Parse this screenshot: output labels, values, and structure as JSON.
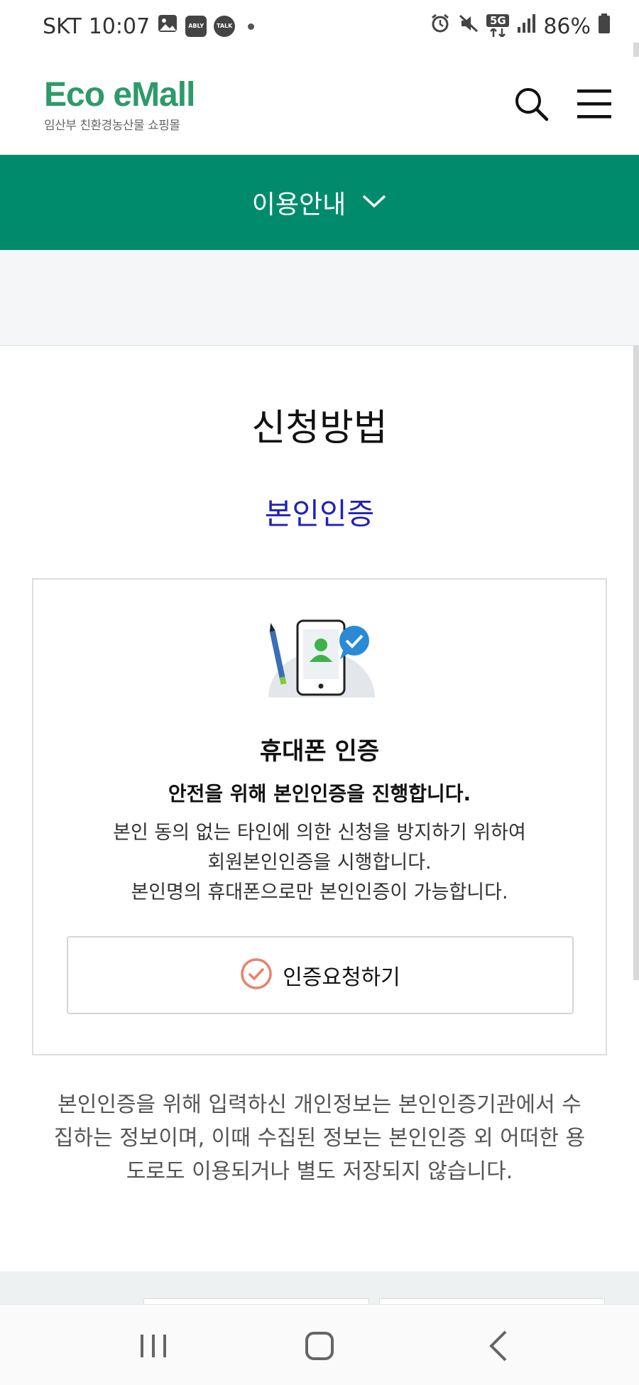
{
  "status_bar": {
    "carrier": "SKT",
    "time": "10:07",
    "notification_icons": [
      "gallery-icon",
      "ably-icon",
      "talk-icon"
    ],
    "ably_label": "ABLY",
    "talk_label": "TALK",
    "right_icons": [
      "alarm-icon",
      "mute-icon",
      "5g-icon",
      "signal-icon"
    ],
    "network_label": "5G",
    "battery": "86%"
  },
  "header": {
    "logo_title": "Eco eMall",
    "logo_subtitle": "임산부 친환경농산물 쇼핑몰",
    "search_icon": "search-icon",
    "menu_icon": "hamburger-menu-icon"
  },
  "guide_nav": {
    "label": "이용안내",
    "icon": "chevron-down-icon"
  },
  "main": {
    "title": "신청방법",
    "subtitle": "본인인증"
  },
  "auth_card": {
    "illustration": "phone-verification-icon",
    "title": "휴대폰 인증",
    "lead": "안전을 위해 본인인증을 진행합니다.",
    "desc_line1": "본인 동의 없는 타인에 의한 신청을 방지하기 위하여",
    "desc_line2": "회원본인인증을 시행합니다.",
    "desc_line3": "본인명의 휴대폰으로만 본인인증이 가능합니다.",
    "button_label": "인증요청하기",
    "button_icon": "check-circle-icon"
  },
  "notice": {
    "line1": "본인인증을 위해 입력하신 개인정보는 본인인증기관에서 수",
    "line2": "집하는 정보이며, 이때 수집된 정보는 본인인증 외 어떠한 용",
    "line3": "도로도 이용되거나 별도 저장되지 않습니다."
  },
  "navigation_bar": {
    "buttons": [
      "recent-apps-icon",
      "home-icon",
      "back-icon"
    ]
  },
  "colors": {
    "brand_green": "#008c6c",
    "logo_green": "#2e9a6a",
    "subtitle_blue": "#2222b8",
    "check_orange": "#e8826a"
  }
}
